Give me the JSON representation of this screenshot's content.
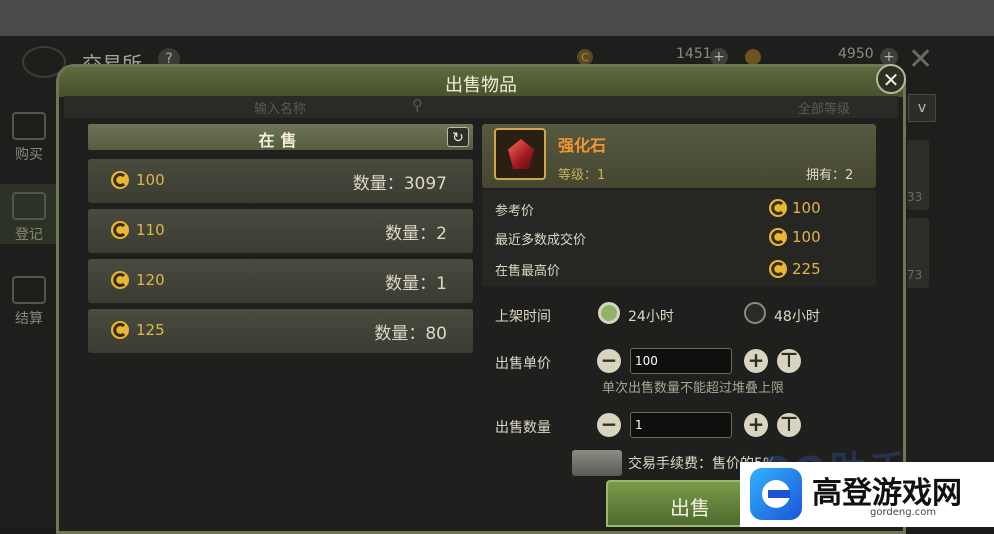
{
  "background": {
    "title": "交易所",
    "help": "?",
    "coin_amount_1": "1451",
    "coin_amount_2": "4950",
    "plus": "+",
    "sidebar": [
      {
        "label": "购买"
      },
      {
        "label": "登记"
      },
      {
        "label": "结算"
      }
    ],
    "search_placeholder": "输入名称",
    "filter": "全部等级",
    "dropdown": "v",
    "right_nums": [
      "33",
      "73"
    ]
  },
  "dialog": {
    "title": "出售物品",
    "close": "✕"
  },
  "listings": {
    "header": "在售",
    "refresh": "↻",
    "rows": [
      {
        "price": "100",
        "qty": "数量：3097"
      },
      {
        "price": "110",
        "qty": "数量：2"
      },
      {
        "price": "120",
        "qty": "数量：1"
      },
      {
        "price": "125",
        "qty": "数量：80"
      }
    ]
  },
  "item": {
    "name": "强化石",
    "level": "等级：1",
    "owned": "拥有：2"
  },
  "info": {
    "ref_price_label": "参考价",
    "ref_price": "100",
    "recent_label": "最近多数成交价",
    "recent": "100",
    "highest_label": "在售最高价",
    "highest": "225"
  },
  "form": {
    "time_label": "上架时间",
    "opt_24": "24小时",
    "opt_48": "48小时",
    "selected": "24小时",
    "price_label": "出售单价",
    "price_value": "100",
    "hint": "单次出售数量不能超过堆叠上限",
    "qty_label": "出售数量",
    "qty_value": "1",
    "minus": "−",
    "plus": "+",
    "max": "⊤",
    "fee": "交易手续费：售价的5%",
    "sell": "出售"
  },
  "watermark": {
    "qq": "QQ助手",
    "site_name": "高登游戏网",
    "site_domain": "gordeng.com"
  },
  "colors": {
    "accent_green": "#5f6a3f",
    "gold": "#e0b54a",
    "item_name": "#f2962e"
  }
}
